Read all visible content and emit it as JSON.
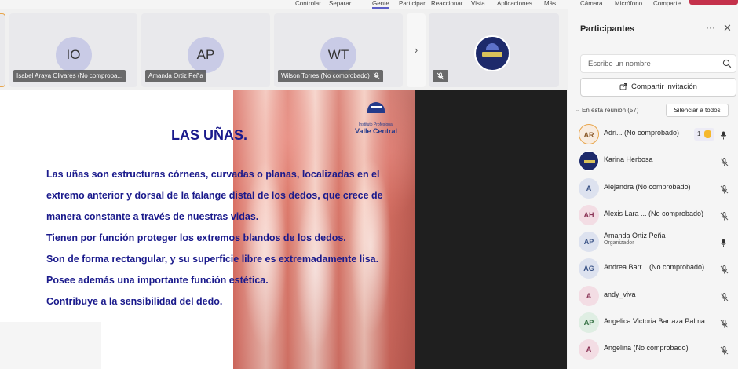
{
  "toolbar": {
    "items": [
      "Controlar",
      "Separar",
      "Gente",
      "Participar",
      "Reaccionar",
      "Vista",
      "Aplicaciones",
      "Más",
      "Cámara",
      "Micrófono",
      "Comparte"
    ]
  },
  "video_tiles": [
    {
      "initials": "IO",
      "name": "Isabel Araya Olivares (No comproba..."
    },
    {
      "initials": "AP",
      "name": "Amanda Ortiz Peña"
    },
    {
      "initials": "WT",
      "name": "Wilson Torres (No comprobado)"
    }
  ],
  "strip_arrow": "›",
  "slide": {
    "logo_line1": "Instituto Profesional",
    "logo_line2": "Valle Central",
    "title": "LAS UÑAS.",
    "lines": [
      "Las uñas son estructuras córneas, curvadas o planas, localizadas en el",
      "extremo anterior y dorsal de la falange distal de los dedos, que crece de",
      "manera constante a través de nuestras vidas.",
      "Tienen por función proteger los extremos blandos de los dedos.",
      "Son de forma rectangular, y su superficie libre es extremadamente lisa.",
      "Posee además una importante función estética.",
      "Contribuye a la sensibilidad del dedo."
    ]
  },
  "panel": {
    "title": "Participantes",
    "more": "···",
    "close": "✕",
    "search_placeholder": "Escribe un nombre",
    "share_label": "Compartir invitación",
    "section_chevron": "⌄",
    "section_label": "En esta reunión (57)",
    "mute_all_label": "Silenciar a todos"
  },
  "participants": [
    {
      "initials": "AR",
      "name": "Adri...  (No comprobado)",
      "hand_count": "1",
      "mic": "on"
    },
    {
      "initials": "",
      "name": "Karina Herbosa",
      "mic": "off"
    },
    {
      "initials": "A",
      "name": "Alejandra (No comprobado)",
      "mic": "off"
    },
    {
      "initials": "AH",
      "name": "Alexis Lara ...   (No comprobado)",
      "mic": "off"
    },
    {
      "initials": "AP",
      "name": "Amanda Ortiz Peña",
      "role": "Organizador",
      "mic": "on"
    },
    {
      "initials": "AG",
      "name": "Andrea Barr...   (No comprobado)",
      "mic": "off"
    },
    {
      "initials": "A",
      "name": "andy_viva",
      "mic": "off"
    },
    {
      "initials": "AP",
      "name": "Angelica Victoria Barraza Palma",
      "mic": "off"
    },
    {
      "initials": "A",
      "name": "Angelina (No comprobado)",
      "mic": "off"
    }
  ],
  "colors": {
    "accent": "#5b5fc7",
    "slide_text": "#1a1a8c",
    "leave": "#c4314b"
  }
}
